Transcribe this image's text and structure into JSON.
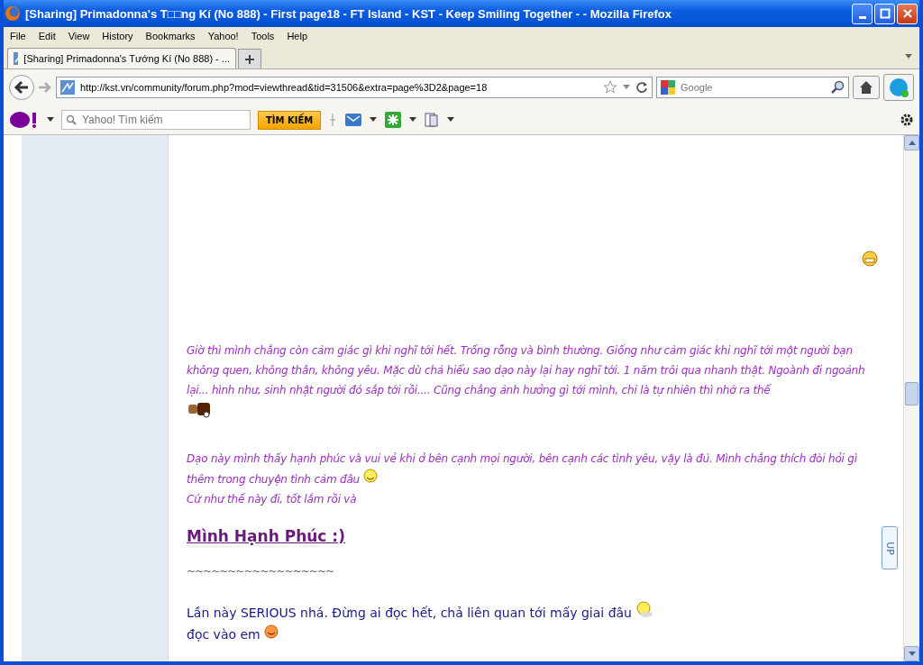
{
  "window": {
    "title": "[Sharing] Primadonna's T□□ng Kí (No 888) - First page18 - FT Island - KST - Keep Smiling Together - - Mozilla Firefox"
  },
  "menu": [
    "File",
    "Edit",
    "View",
    "History",
    "Bookmarks",
    "Yahoo!",
    "Tools",
    "Help"
  ],
  "tabs": [
    {
      "label": "[Sharing] Primadonna's Tướng Kí (No 888) - ...",
      "selected": true
    }
  ],
  "nav": {
    "url": "http://kst.vn/community/forum.php?mod=viewthread&tid=31506&extra=page%3D2&page=18",
    "search_placeholder": "Google"
  },
  "yahoo_toolbar": {
    "search_placeholder": "Yahoo! Tìm kiếm",
    "search_button": "TÌM KIẾM"
  },
  "post": {
    "italic_paragraphs": [
      "Giờ thì mình chẳng còn cảm giác gì khi nghĩ tới hết. Trống rỗng và bình thường. Giống như cảm giác khi nghĩ tới một người bạn không quen, không thân, không yêu. Mặc dù chả hiểu sao dạo này lại hay nghĩ tới. 1 năm trôi qua nhanh thật. Ngoành đi ngoảnh lại... hình như, sinh nhật người đó sắp tới rồi.... Cũng chẳng ảnh hưởng gì tới mình, chỉ là tự nhiên thì nhớ ra thế",
      "Dạo này mình thấy hạnh phúc và vui vẻ khi ở bên cạnh mọi người, bên cạnh các tình yêu, vậy là đủ. Mình chẳng thích đòi hỏi gì thêm trong chuyện tình cảm đâu",
      "Cứ như thế này đi, tốt lắm rồi và"
    ],
    "heading": "Mình Hạnh Phúc :)",
    "separator": "~~~~~~~~~~~~~~~~~~",
    "lines": [
      "Lần này SERIOUS nhá. Đừng ai đọc hết, chả liên quan tới mấy giai đâu",
      "đọc vào em"
    ],
    "up_button": "UP"
  }
}
